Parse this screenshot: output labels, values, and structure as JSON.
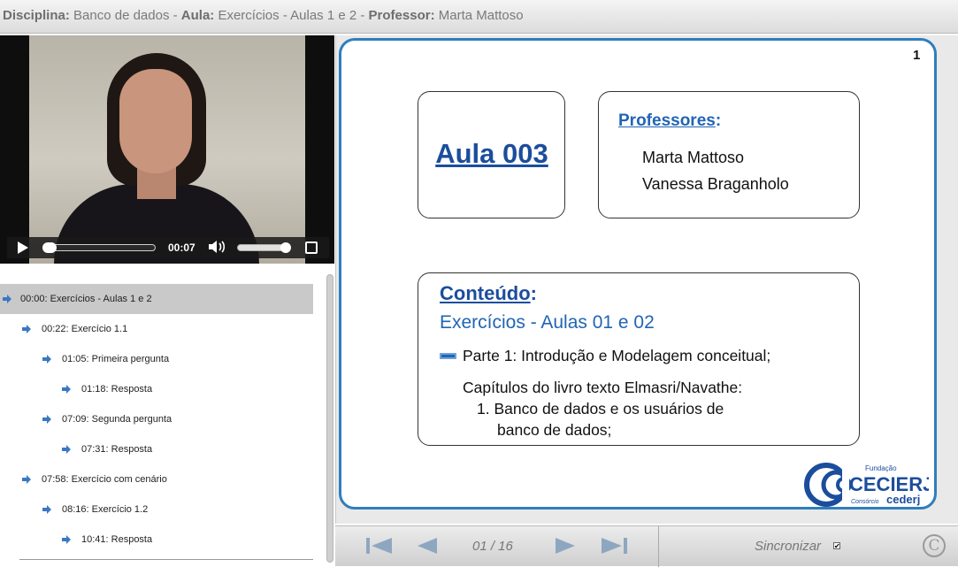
{
  "header": {
    "disciplina_label": "Disciplina:",
    "disciplina_value": " Banco de dados -",
    "aula_label": "Aula:",
    "aula_value": " Exercícios - Aulas 1 e 2 -",
    "professor_label": "Professor:",
    "professor_value": " Marta Mattoso"
  },
  "player": {
    "current_time": "00:07"
  },
  "index": {
    "items": [
      {
        "label": "00:00: Exercícios - Aulas 1 e 2",
        "level": 0,
        "active": true
      },
      {
        "label": "00:22: Exercício 1.1",
        "level": 1
      },
      {
        "label": "01:05: Primeira pergunta",
        "level": 2
      },
      {
        "label": "01:18: Resposta",
        "level": 3
      },
      {
        "label": "07:09: Segunda pergunta",
        "level": 2
      },
      {
        "label": "07:31: Resposta",
        "level": 3
      },
      {
        "label": "07:58: Exercício com cenário",
        "level": 1
      },
      {
        "label": "08:16: Exercício 1.2",
        "level": 2
      },
      {
        "label": "10:41: Resposta",
        "level": 3
      }
    ]
  },
  "slide": {
    "number": "1",
    "aula_title": "Aula 003",
    "professores_label": "Professores",
    "professores_colon": ":",
    "professores": [
      "Marta Mattoso",
      "Vanessa Braganholo"
    ],
    "conteudo_label": "Conteúdo",
    "conteudo_colon": ":",
    "conteudo_subtitle": "Exercícios - Aulas 01 e 02",
    "part1": "Parte 1: Introdução e Modelagem conceitual;",
    "chapters": "Capítulos do livro texto Elmasri/Navathe:",
    "item1_line1": "1. Banco de dados e os usuários de",
    "item1_line2": "banco de dados;",
    "logo_top": "Fundação",
    "logo_main": "CECIERJ",
    "logo_bottom_small": "Consórcio",
    "logo_bottom": "cederj"
  },
  "nav": {
    "page_indicator": "01 / 16",
    "sync_label": "Sincronizar",
    "sync_checked": "✔",
    "copyright": "C"
  },
  "colors": {
    "accent": "#2f7ebd",
    "title_blue": "#1b4d9c",
    "arrow_blue": "#3a78c2"
  }
}
